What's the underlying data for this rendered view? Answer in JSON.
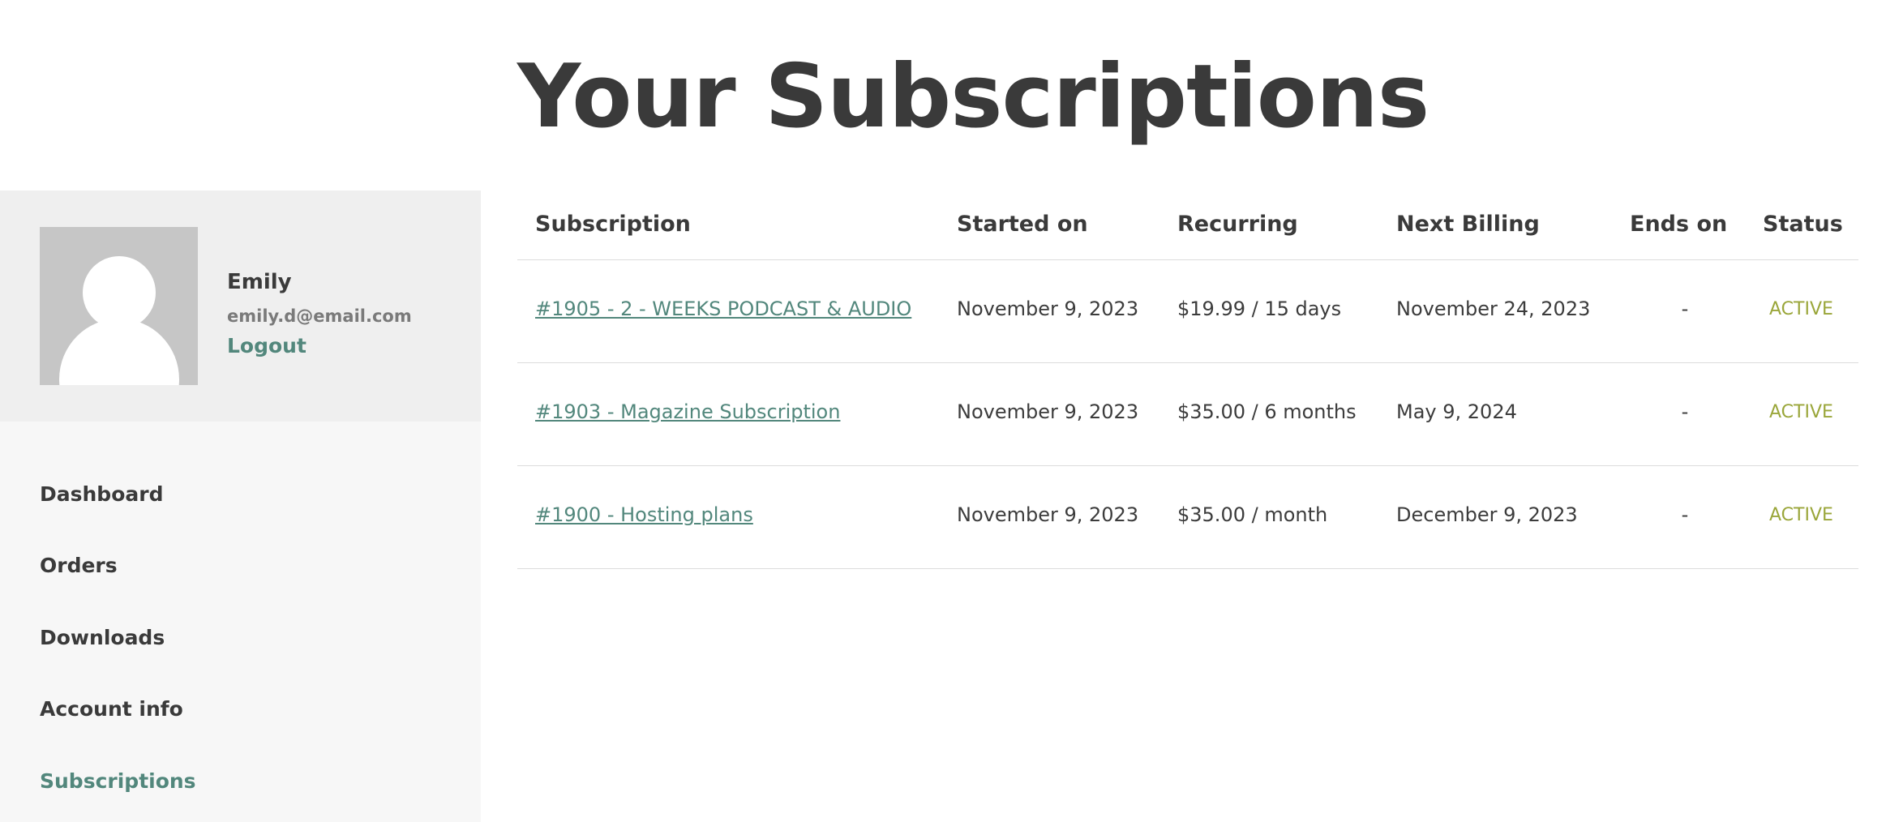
{
  "page": {
    "title": "Your Subscriptions"
  },
  "profile": {
    "name": "Emily",
    "email": "emily.d@email.com",
    "logout_label": "Logout"
  },
  "nav": {
    "items": [
      {
        "label": "Dashboard",
        "active": false
      },
      {
        "label": "Orders",
        "active": false
      },
      {
        "label": "Downloads",
        "active": false
      },
      {
        "label": "Account info",
        "active": false
      },
      {
        "label": "Subscriptions",
        "active": true
      }
    ]
  },
  "table": {
    "headers": [
      "Subscription",
      "Started on",
      "Recurring",
      "Next Billing",
      "Ends on",
      "Status"
    ],
    "rows": [
      {
        "subscription": "#1905 - 2 - WEEKS PODCAST & AUDIO",
        "started_on": "November 9, 2023",
        "recurring": "$19.99 / 15 days",
        "next_billing": "November 24, 2023",
        "ends_on": "-",
        "status": "ACTIVE"
      },
      {
        "subscription": "#1903 - Magazine Subscription",
        "started_on": "November 9, 2023",
        "recurring": "$35.00 / 6 months",
        "next_billing": "May 9, 2024",
        "ends_on": "-",
        "status": "ACTIVE"
      },
      {
        "subscription": "#1900 - Hosting plans",
        "started_on": "November 9, 2023",
        "recurring": "$35.00 / month",
        "next_billing": "December 9, 2023",
        "ends_on": "-",
        "status": "ACTIVE"
      }
    ]
  },
  "colors": {
    "accent": "#52877c",
    "status_active": "#9aa63a",
    "sidebar_bg": "#f7f7f7",
    "profile_bg": "#efefef",
    "avatar_bg": "#c6c6c6"
  }
}
